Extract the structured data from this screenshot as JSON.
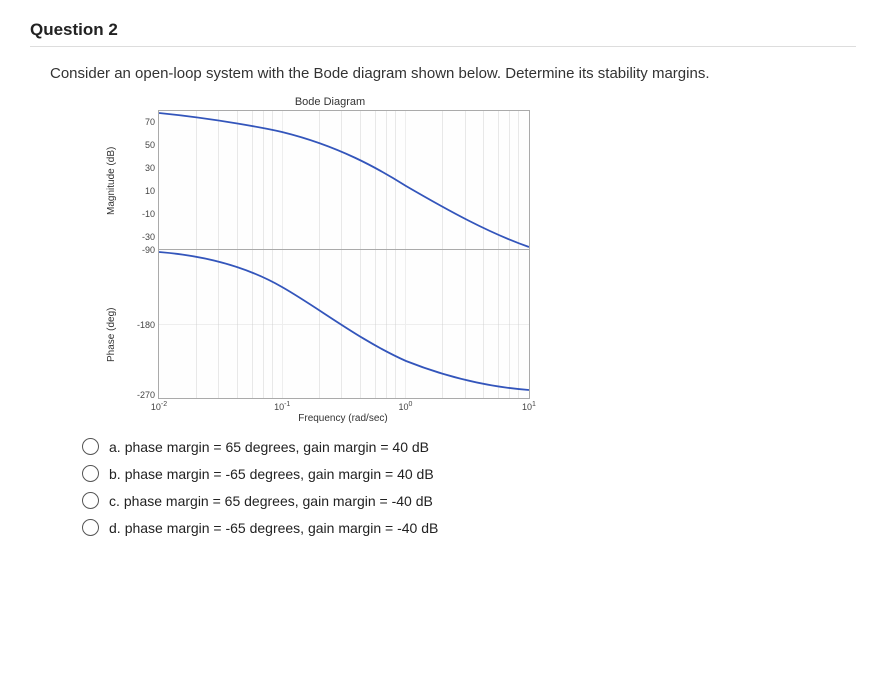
{
  "question": {
    "title": "Question 2",
    "text": "Consider an open-loop system with the Bode diagram shown below. Determine its stability margins."
  },
  "chart_data": [
    {
      "type": "line",
      "title": "Bode Diagram",
      "panel": "magnitude",
      "ylabel": "Magnitude (dB)",
      "yticks": [
        70,
        50,
        30,
        10,
        -10,
        -30
      ],
      "ylim": [
        -40,
        80
      ],
      "x_log_decades": [
        -2,
        -1,
        0,
        1
      ],
      "series": [
        {
          "name": "mag",
          "x_log": [
            -2,
            -1.5,
            -1,
            -0.5,
            0,
            0.5,
            1
          ],
          "values": [
            78,
            73,
            62,
            42,
            15,
            -15,
            -40
          ]
        }
      ]
    },
    {
      "type": "line",
      "panel": "phase",
      "ylabel": "Phase (deg)",
      "yticks": [
        -90,
        -180,
        -270
      ],
      "ylim": [
        -270,
        -90
      ],
      "xlabel": "Frequency (rad/sec)",
      "x_log_decades": [
        -2,
        -1,
        0,
        1
      ],
      "xticks": [
        "10^-2",
        "10^-1",
        "10^0",
        "10^1"
      ],
      "series": [
        {
          "name": "phase",
          "x_log": [
            -2,
            -1.5,
            -1,
            -0.5,
            0,
            0.5,
            1
          ],
          "values": [
            -92,
            -105,
            -135,
            -180,
            -225,
            -250,
            -260
          ]
        }
      ]
    }
  ],
  "answers": {
    "a": {
      "letter": "a.",
      "text": "phase margin = 65 degrees, gain margin = 40 dB"
    },
    "b": {
      "letter": "b.",
      "text": "phase margin = -65 degrees, gain margin = 40 dB"
    },
    "c": {
      "letter": "c.",
      "text": "phase margin = 65 degrees, gain margin = -40 dB"
    },
    "d": {
      "letter": "d.",
      "text": "phase margin = -65 degrees, gain margin = -40 dB"
    }
  }
}
